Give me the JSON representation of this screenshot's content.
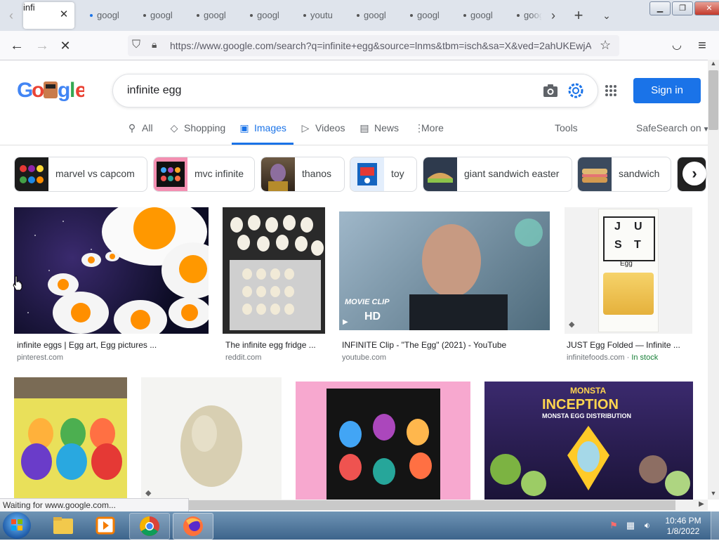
{
  "browser": {
    "tabs": [
      {
        "label": "infi",
        "active": true
      },
      {
        "label": "googl",
        "active": false,
        "indicator_color": "#1a73e8"
      },
      {
        "label": "googl",
        "active": false
      },
      {
        "label": "googl",
        "active": false
      },
      {
        "label": "googl",
        "active": false
      },
      {
        "label": "youtu",
        "active": false
      },
      {
        "label": "googl",
        "active": false
      },
      {
        "label": "googl",
        "active": false
      },
      {
        "label": "googl",
        "active": false
      },
      {
        "label": "goog",
        "active": false
      }
    ],
    "url": "https://www.google.com/search?q=infinite+egg&source=lnms&tbm=isch&sa=X&ved=2ahUKEwjA",
    "status_text": "Waiting for www.google.com..."
  },
  "google": {
    "logo_text": "Google",
    "query": "infinite egg",
    "signin_label": "Sign in",
    "search_tabs": [
      {
        "label": "All",
        "icon": "search-icon"
      },
      {
        "label": "Shopping",
        "icon": "tag-icon"
      },
      {
        "label": "Images",
        "icon": "image-icon",
        "active": true
      },
      {
        "label": "Videos",
        "icon": "play-icon"
      },
      {
        "label": "News",
        "icon": "news-icon"
      },
      {
        "label": "More",
        "icon": "more-vert-icon"
      }
    ],
    "tools_label": "Tools",
    "safesearch_label": "SafeSearch on",
    "chips": [
      {
        "label": "marvel vs capcom"
      },
      {
        "label": "mvc infinite"
      },
      {
        "label": "thanos"
      },
      {
        "label": "toy"
      },
      {
        "label": "giant sandwich easter"
      },
      {
        "label": "sandwich"
      }
    ],
    "results": [
      {
        "title": "infinite eggs | Egg art, Egg pictures ...",
        "source": "pinterest.com"
      },
      {
        "title": "The infinite egg fridge ...",
        "source": "reddit.com"
      },
      {
        "title": "INFINITE Clip - \"The Egg\" (2021) - YouTube",
        "source": "youtube.com",
        "overlay": "MOVIE CLIP",
        "badge": "HD"
      },
      {
        "title": "JUST Egg Folded — Infinite ...",
        "source": "infinitefoods.com",
        "stock": "In stock",
        "package_text": [
          "J",
          "U",
          "S",
          "T"
        ],
        "package_label": "Egg"
      },
      {
        "title": "",
        "source": ""
      },
      {
        "title": "",
        "source": ""
      },
      {
        "title": "",
        "source": ""
      },
      {
        "title": "",
        "source": "",
        "overlay_brand": "MONSTA",
        "overlay_title": "INCEPTION",
        "overlay_sub": "MONSTA EGG DISTRIBUTION"
      }
    ]
  },
  "taskbar": {
    "time": "10:46 PM",
    "date": "1/8/2022"
  },
  "colors": {
    "accent": "#1a73e8",
    "tabbar_bg": "#dfe4ec",
    "stock_green": "#188038"
  }
}
